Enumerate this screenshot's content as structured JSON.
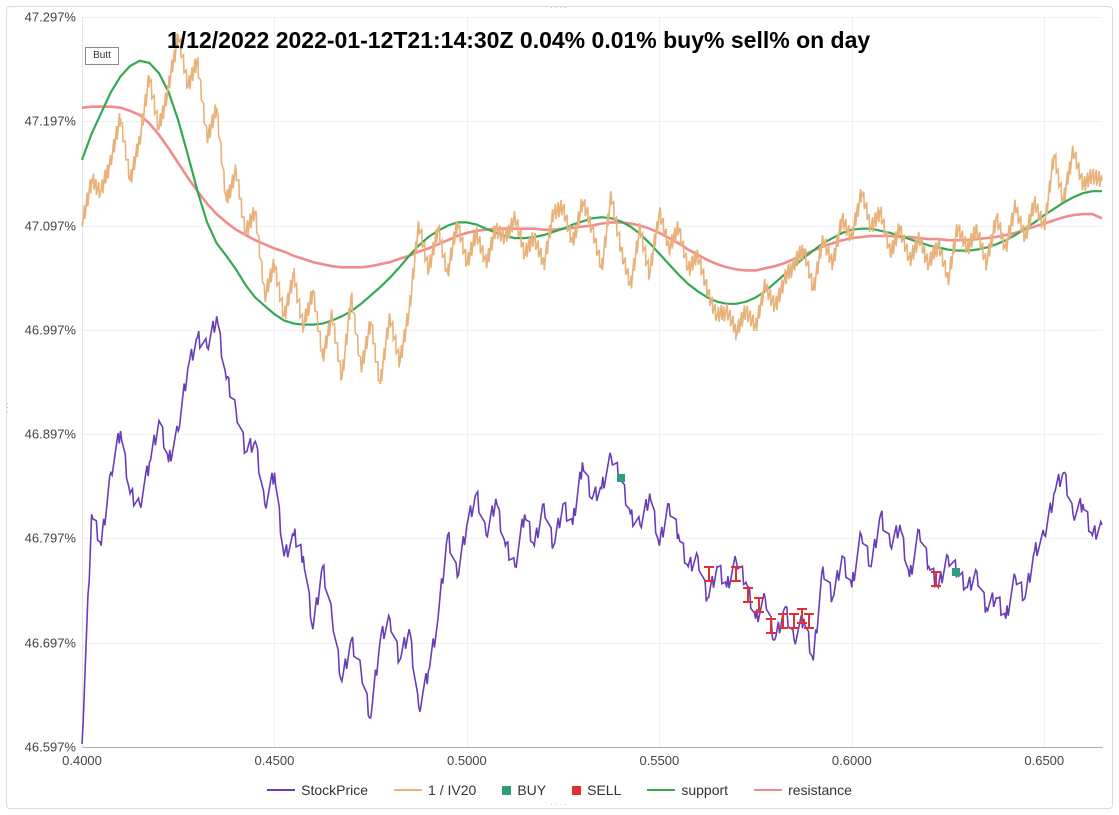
{
  "title": "1/12/2022 2022-01-12T21:14:30Z 0.04% 0.01% buy% sell% on day",
  "button_label": "Butt",
  "legend": [
    {
      "name": "StockPrice",
      "type": "line",
      "color": "#6a3db8"
    },
    {
      "name": "1 / IV20",
      "type": "line",
      "color": "#e8b27a"
    },
    {
      "name": "BUY",
      "type": "marker",
      "color": "#2e9e7a"
    },
    {
      "name": "SELL",
      "type": "marker",
      "color": "#e03030"
    },
    {
      "name": "support",
      "type": "line",
      "color": "#34a853"
    },
    {
      "name": "resistance",
      "type": "line",
      "color": "#f28b8b"
    }
  ],
  "chart_data": {
    "type": "line",
    "xlabel": "",
    "ylabel": "",
    "xlim": [
      0.4,
      0.665
    ],
    "ylim": [
      46.597,
      47.297
    ],
    "x_ticks": [
      0.4,
      0.45,
      0.5,
      0.55,
      0.6,
      0.65
    ],
    "x_tick_labels": [
      "0.4000",
      "0.4500",
      "0.5000",
      "0.5500",
      "0.6000",
      "0.6500"
    ],
    "y_ticks": [
      46.597,
      46.697,
      46.797,
      46.897,
      46.997,
      47.097,
      47.197,
      47.297
    ],
    "y_tick_labels": [
      "46.597%",
      "46.697%",
      "46.797%",
      "46.897%",
      "46.997%",
      "47.097%",
      "47.197%",
      "47.297%"
    ],
    "x": [
      0.4,
      0.4025,
      0.405,
      0.4075,
      0.41,
      0.4125,
      0.415,
      0.4175,
      0.42,
      0.4225,
      0.425,
      0.4275,
      0.43,
      0.4325,
      0.435,
      0.4375,
      0.44,
      0.4425,
      0.445,
      0.4475,
      0.45,
      0.4525,
      0.455,
      0.4575,
      0.46,
      0.4625,
      0.465,
      0.4675,
      0.47,
      0.4725,
      0.475,
      0.4775,
      0.48,
      0.4825,
      0.485,
      0.4875,
      0.49,
      0.4925,
      0.495,
      0.4975,
      0.5,
      0.5025,
      0.505,
      0.5075,
      0.51,
      0.5125,
      0.515,
      0.5175,
      0.52,
      0.5225,
      0.525,
      0.5275,
      0.53,
      0.5325,
      0.535,
      0.5375,
      0.54,
      0.5425,
      0.545,
      0.5475,
      0.55,
      0.5525,
      0.555,
      0.5575,
      0.56,
      0.5625,
      0.565,
      0.5675,
      0.57,
      0.5725,
      0.575,
      0.5775,
      0.58,
      0.5825,
      0.585,
      0.5875,
      0.59,
      0.5925,
      0.595,
      0.5975,
      0.6,
      0.6025,
      0.605,
      0.6075,
      0.61,
      0.6125,
      0.615,
      0.6175,
      0.62,
      0.6225,
      0.625,
      0.6275,
      0.63,
      0.6325,
      0.635,
      0.6375,
      0.64,
      0.6425,
      0.645,
      0.6475,
      0.65,
      0.6525,
      0.655,
      0.6575,
      0.66,
      0.6625,
      0.665
    ],
    "series": [
      {
        "name": "StockPrice",
        "color": "#6a3db8",
        "width": 1.6,
        "values": [
          46.6,
          46.82,
          46.79,
          46.86,
          46.9,
          46.84,
          46.83,
          46.87,
          46.91,
          46.87,
          46.9,
          46.96,
          46.99,
          46.98,
          47.01,
          46.95,
          46.92,
          46.88,
          46.89,
          46.83,
          46.86,
          46.78,
          46.8,
          46.78,
          46.71,
          46.77,
          46.72,
          46.66,
          46.7,
          46.67,
          46.625,
          46.7,
          46.72,
          46.68,
          46.71,
          46.635,
          46.67,
          46.72,
          46.8,
          46.76,
          46.81,
          46.84,
          46.8,
          46.835,
          46.79,
          46.77,
          46.82,
          46.79,
          46.83,
          46.79,
          46.83,
          46.81,
          46.87,
          46.835,
          46.845,
          46.875,
          46.855,
          46.82,
          46.81,
          46.84,
          46.79,
          46.83,
          46.8,
          46.77,
          46.78,
          46.74,
          46.77,
          46.75,
          46.775,
          46.755,
          46.72,
          46.74,
          46.7,
          46.73,
          46.7,
          46.72,
          46.68,
          46.77,
          46.74,
          46.78,
          46.75,
          46.8,
          46.77,
          46.82,
          46.79,
          46.81,
          46.76,
          46.805,
          46.77,
          46.75,
          46.78,
          46.765,
          46.75,
          46.765,
          46.73,
          46.74,
          46.72,
          46.76,
          46.74,
          46.785,
          46.8,
          46.84,
          46.86,
          46.82,
          46.83,
          46.8,
          46.81
        ],
        "sub": 8
      },
      {
        "name": "1 / IV20",
        "color": "#e8b27a",
        "width": 1.6,
        "values": [
          47.1,
          47.14,
          47.13,
          47.16,
          47.2,
          47.14,
          47.18,
          47.24,
          47.19,
          47.23,
          47.28,
          47.23,
          47.255,
          47.18,
          47.21,
          47.12,
          47.15,
          47.09,
          47.11,
          47.03,
          47.06,
          47.01,
          47.05,
          47.0,
          47.035,
          46.97,
          47.01,
          46.95,
          47.03,
          46.96,
          47.005,
          46.945,
          47.01,
          46.965,
          47.015,
          47.1,
          47.055,
          47.095,
          47.05,
          47.1,
          47.06,
          47.09,
          47.06,
          47.095,
          47.085,
          47.105,
          47.07,
          47.085,
          47.06,
          47.11,
          47.115,
          47.08,
          47.12,
          47.095,
          47.055,
          47.125,
          47.075,
          47.04,
          47.095,
          47.05,
          47.11,
          47.075,
          47.095,
          47.055,
          47.07,
          47.035,
          47.01,
          47.015,
          46.995,
          47.015,
          47.0,
          47.04,
          47.02,
          47.045,
          47.06,
          47.075,
          47.035,
          47.085,
          47.06,
          47.105,
          47.085,
          47.13,
          47.095,
          47.11,
          47.07,
          47.095,
          47.065,
          47.085,
          47.06,
          47.08,
          47.045,
          47.095,
          47.075,
          47.095,
          47.06,
          47.105,
          47.075,
          47.115,
          47.085,
          47.12,
          47.095,
          47.165,
          47.12,
          47.17,
          47.135,
          47.145,
          47.14
        ],
        "sub": 20
      },
      {
        "name": "support",
        "color": "#34a853",
        "width": 2.2,
        "values": [
          47.16,
          47.185,
          47.205,
          47.225,
          47.24,
          47.25,
          47.255,
          47.253,
          47.243,
          47.225,
          47.198,
          47.165,
          47.13,
          47.1,
          47.08,
          47.068,
          47.055,
          47.04,
          47.028,
          47.02,
          47.012,
          47.006,
          47.003,
          47.002,
          47.002,
          47.003,
          47.006,
          47.01,
          47.015,
          47.022,
          47.03,
          47.038,
          47.047,
          47.057,
          47.068,
          47.078,
          47.086,
          47.092,
          47.097,
          47.1,
          47.1,
          47.098,
          47.094,
          47.09,
          47.087,
          47.085,
          47.085,
          47.086,
          47.088,
          47.091,
          47.094,
          47.098,
          47.101,
          47.104,
          47.105,
          47.104,
          47.101,
          47.096,
          47.089,
          47.08,
          47.07,
          47.06,
          47.05,
          47.041,
          47.034,
          47.028,
          47.024,
          47.022,
          47.022,
          47.024,
          47.028,
          47.034,
          47.042,
          47.05,
          47.058,
          47.066,
          47.073,
          47.08,
          47.085,
          47.09,
          47.093,
          47.094,
          47.094,
          47.092,
          47.09,
          47.087,
          47.084,
          47.081,
          47.078,
          47.076,
          47.074,
          47.073,
          47.073,
          47.074,
          47.076,
          47.079,
          47.083,
          47.088,
          47.094,
          47.1,
          47.107,
          47.113,
          47.119,
          47.124,
          47.128,
          47.13,
          47.13
        ]
      },
      {
        "name": "resistance",
        "color": "#f28b8b",
        "width": 2.6,
        "values": [
          47.21,
          47.211,
          47.211,
          47.211,
          47.21,
          47.207,
          47.203,
          47.195,
          47.184,
          47.171,
          47.157,
          47.143,
          47.13,
          47.118,
          47.108,
          47.1,
          47.093,
          47.088,
          47.083,
          47.079,
          47.075,
          47.072,
          47.068,
          47.065,
          47.062,
          47.06,
          47.058,
          47.057,
          47.057,
          47.057,
          47.058,
          47.06,
          47.062,
          47.065,
          47.068,
          47.072,
          47.075,
          47.079,
          47.083,
          47.087,
          47.09,
          47.092,
          47.093,
          47.094,
          47.094,
          47.094,
          47.094,
          47.094,
          47.093,
          47.093,
          47.094,
          47.095,
          47.096,
          47.097,
          47.099,
          47.1,
          47.1,
          47.099,
          47.097,
          47.094,
          47.09,
          47.085,
          47.08,
          47.074,
          47.069,
          47.064,
          47.06,
          47.057,
          47.055,
          47.054,
          47.054,
          47.056,
          47.058,
          47.061,
          47.065,
          47.069,
          47.073,
          47.077,
          47.08,
          47.083,
          47.085,
          47.086,
          47.087,
          47.087,
          47.087,
          47.086,
          47.086,
          47.085,
          47.084,
          47.084,
          47.083,
          47.083,
          47.083,
          47.084,
          47.085,
          47.086,
          47.088,
          47.09,
          47.093,
          47.096,
          47.099,
          47.102,
          47.105,
          47.107,
          47.108,
          47.108,
          47.104
        ]
      }
    ],
    "markers": {
      "BUY": {
        "color": "#2e9e7a",
        "points": [
          {
            "x": 0.54,
            "y": 46.855
          },
          {
            "x": 0.627,
            "y": 46.765
          }
        ]
      },
      "SELL": {
        "color": "#e03030",
        "points": [
          {
            "x": 0.563,
            "y": 46.765
          },
          {
            "x": 0.57,
            "y": 46.765
          },
          {
            "x": 0.573,
            "y": 46.745
          },
          {
            "x": 0.576,
            "y": 46.735
          },
          {
            "x": 0.579,
            "y": 46.715
          },
          {
            "x": 0.582,
            "y": 46.72
          },
          {
            "x": 0.585,
            "y": 46.72
          },
          {
            "x": 0.587,
            "y": 46.725
          },
          {
            "x": 0.589,
            "y": 46.72
          },
          {
            "x": 0.622,
            "y": 46.76
          }
        ]
      }
    }
  },
  "geometry": {
    "plot_left": 75,
    "plot_top": 10,
    "plot_right": 1095,
    "plot_bottom": 740,
    "xaxis_y": 740,
    "legend_y": 782
  },
  "colors": {
    "grid": "#f0f0f0",
    "text": "#444"
  }
}
